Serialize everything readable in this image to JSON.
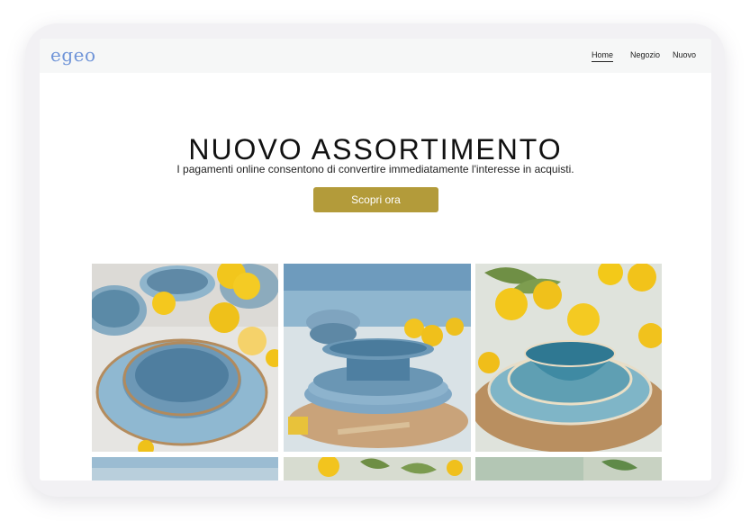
{
  "brand": {
    "logo": "egeo",
    "logo_color": "#6f94d8"
  },
  "nav": {
    "items": [
      {
        "label": "Home",
        "active": true
      },
      {
        "label": "Negozio",
        "active": false
      },
      {
        "label": "Nuovo",
        "active": false
      }
    ]
  },
  "hero": {
    "title": "NUOVO ASSORTIMENTO",
    "subtitle": "I pagamenti online consentono di convertire immediatamente l'interesse in acquisti.",
    "cta_label": "Scopri ora",
    "cta_color": "#b39b3a"
  },
  "gallery": {
    "images": [
      {
        "icon": "blue-ceramic-bowls-with-lemons-image"
      },
      {
        "icon": "stacked-blue-ceramic-plates-image"
      },
      {
        "icon": "turquoise-bowl-on-rattan-placemat-image"
      },
      {
        "icon": "sea-view-tableware-image"
      },
      {
        "icon": "lemons-and-greenery-image"
      },
      {
        "icon": "garden-table-image"
      }
    ]
  }
}
